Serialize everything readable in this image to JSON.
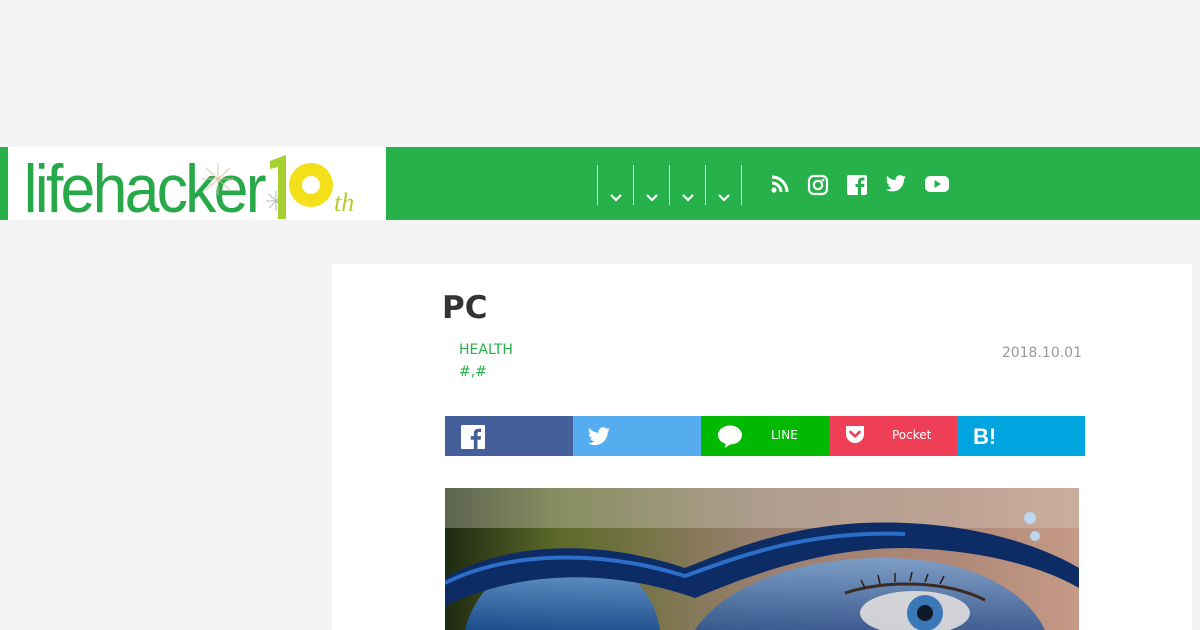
{
  "header": {
    "logo_text": "lifehacker",
    "logo_anniversary": "10th",
    "nav_menus": [
      "menu-1",
      "menu-2",
      "menu-3",
      "menu-4"
    ],
    "social_icons": [
      "rss-icon",
      "instagram-icon",
      "facebook-icon",
      "twitter-icon",
      "youtube-icon"
    ]
  },
  "article": {
    "title": "PC",
    "category": "HEALTH",
    "tags": "#,#",
    "date": "2018.10.01"
  },
  "share": {
    "facebook_label": "",
    "twitter_label": "",
    "line_label": "LINE",
    "pocket_label": "Pocket",
    "hatena_label": ""
  },
  "colors": {
    "brand_green": "#27b14a",
    "facebook": "#455f9a",
    "twitter": "#55acee",
    "line": "#00b900",
    "pocket": "#ef3f56",
    "hatena": "#00a4de"
  }
}
